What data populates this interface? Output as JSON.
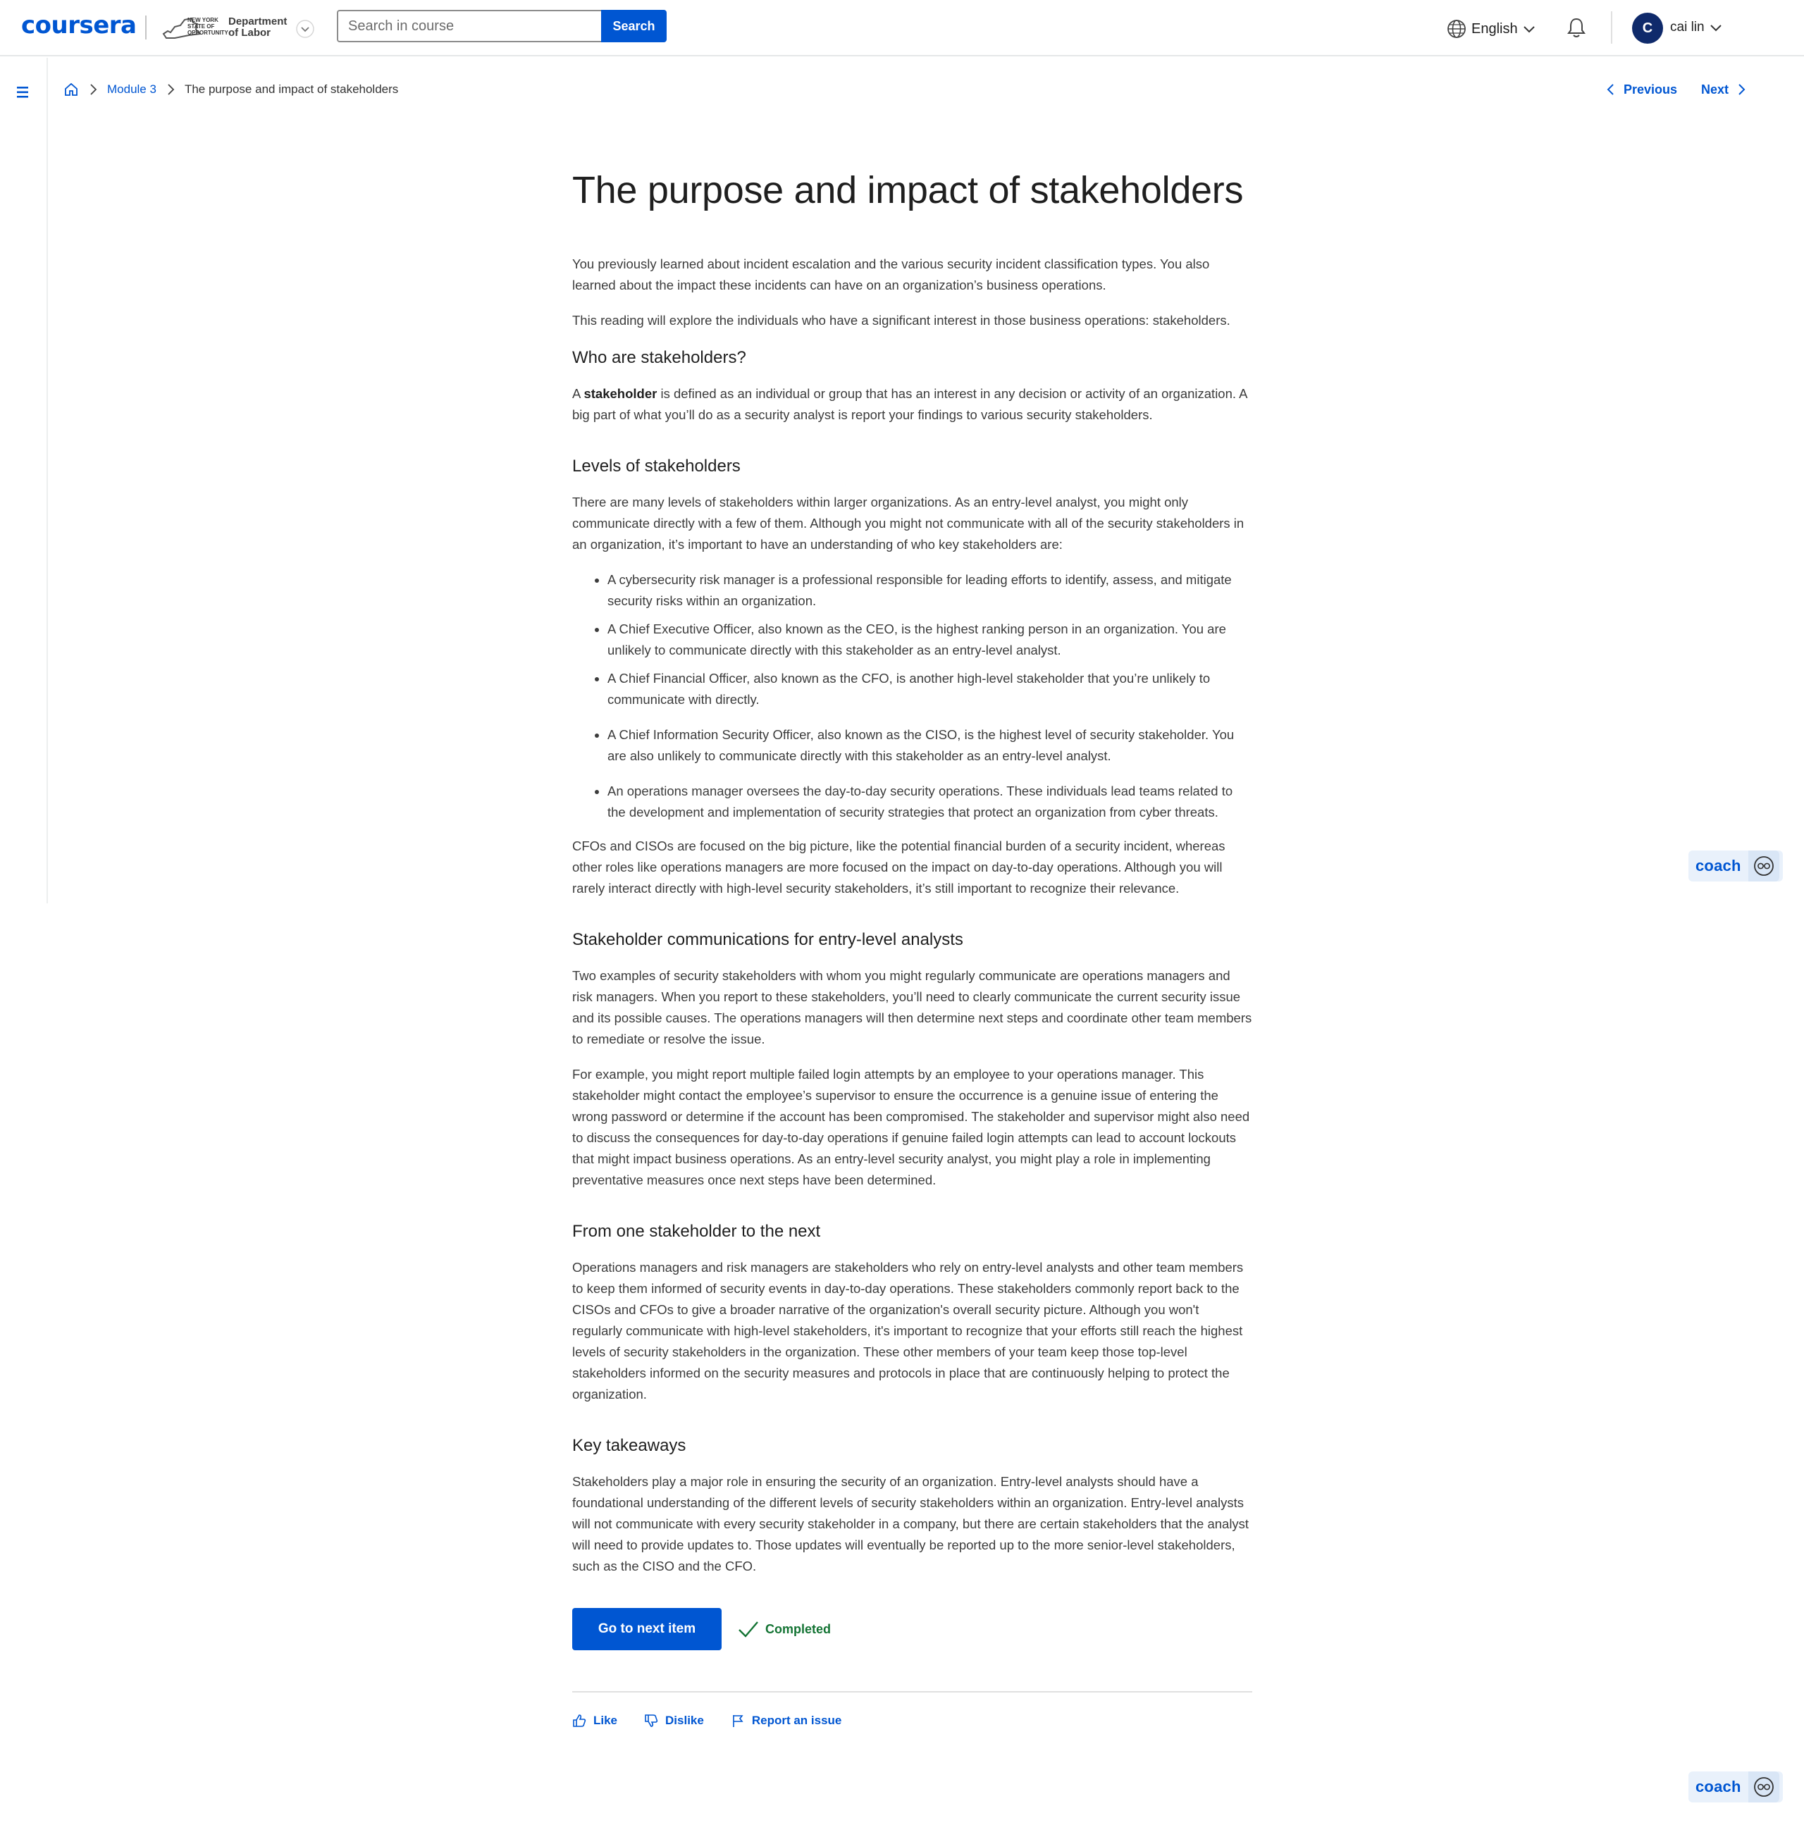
{
  "header": {
    "logo": "coursera",
    "partner_small": "NEW YORK STATE OF OPPORTUNITY",
    "partner_name": "Department of Labor",
    "search_placeholder": "Search in course",
    "search_button": "Search",
    "language": "English",
    "avatar_initial": "C",
    "user_name": "cai lin"
  },
  "breadcrumb": {
    "module": "Module 3",
    "current": "The purpose and impact of stakeholders"
  },
  "nav": {
    "previous": "Previous",
    "next": "Next"
  },
  "article": {
    "title": "The purpose and impact of stakeholders",
    "intro_p1": "You previously learned about incident escalation and the various security incident classification types. You also learned about the impact these incidents can have on an organization’s business operations.",
    "intro_p2": "This reading will explore the individuals who have a significant interest in those business operations: stakeholders.",
    "h_who": "Who are stakeholders?",
    "who_prefix": "A ",
    "who_term": "stakeholder",
    "who_rest": " is defined as an individual or group that has an interest in any decision or activity of an organization. A big part of what you’ll do as a security analyst is report your findings to various security stakeholders.",
    "h_levels": "Levels of stakeholders",
    "levels_p": "There are many levels of stakeholders within larger organizations. As an entry-level analyst, you might only communicate directly with a few of them. Although you might not communicate with all of the security stakeholders in an organization, it’s important to have an understanding of who key stakeholders are:",
    "bullets": [
      "A cybersecurity risk manager is a professional responsible for leading efforts to identify, assess, and mitigate security risks within an organization.",
      "A Chief Executive Officer, also known as the CEO, is the highest ranking person in an organization. You are unlikely to communicate directly with this stakeholder as an entry-level analyst.",
      "A Chief Financial Officer, also known as the CFO, is another high-level stakeholder that you’re unlikely to communicate with directly.",
      "A Chief Information Security Officer, also known as the CISO, is the highest level of security stakeholder. You are also unlikely to communicate directly with this stakeholder as an entry-level analyst.",
      "An operations manager oversees the day-to-day security operations. These individuals lead teams related to the development and implementation of security strategies that protect an organization from cyber threats."
    ],
    "levels_p2": "CFOs and CISOs are focused on the big picture, like the potential financial burden of a security incident, whereas other roles like operations managers are more focused on the impact on day-to-day operations. Although you will rarely interact directly with high-level security stakeholders, it’s still important to recognize their relevance.",
    "h_comms": "Stakeholder communications for entry-level analysts",
    "comms_p1": "Two examples of security stakeholders with whom you might regularly communicate are operations managers and risk managers. When you report to these stakeholders, you’ll need to clearly communicate the current security issue and its possible causes. The operations managers will then determine next steps and coordinate other team members to remediate or resolve the issue.",
    "comms_p2": "For example, you might report multiple failed login attempts by an employee to your operations manager. This stakeholder might contact the employee’s supervisor to ensure the occurrence is a genuine issue of entering the wrong password or determine if the account has been compromised. The stakeholder and supervisor might also need to discuss the consequences for day-to-day operations if genuine failed login attempts can lead to account lockouts that might impact business operations. As an entry-level security analyst, you might play a role in implementing preventative measures once next steps have been determined.",
    "h_next": "From one stakeholder to the next",
    "next_p": "Operations managers and risk managers are stakeholders who rely on entry-level analysts and other team members to keep them informed of security events in day-to-day operations. These stakeholders commonly report back to the CISOs and CFOs to give a broader narrative of the organization's overall security picture. Although you won't regularly communicate with high-level stakeholders, it's important to recognize that your efforts still reach the highest levels of security stakeholders in the organization. These other members of your team keep those top-level stakeholders informed on the security measures and protocols in place that are continuously helping to protect the organization.",
    "h_key": "Key takeaways",
    "key_p": "Stakeholders play a major role in ensuring the security of an organization. Entry-level analysts should have a foundational understanding of the different levels of security stakeholders within an organization. Entry-level analysts will not communicate with every security stakeholder in a company, but there are certain stakeholders that the analyst will need to provide updates to. Those updates will eventually be reported up to the more senior-level stakeholders, such as the CISO and the CFO."
  },
  "actions": {
    "next_item": "Go to next item",
    "completed": "Completed",
    "like": "Like",
    "dislike": "Dislike",
    "report": "Report an issue"
  },
  "coach": {
    "label": "coach"
  },
  "colors": {
    "brand": "#0056d2",
    "success": "#137333",
    "avatar": "#0f2a6b"
  }
}
